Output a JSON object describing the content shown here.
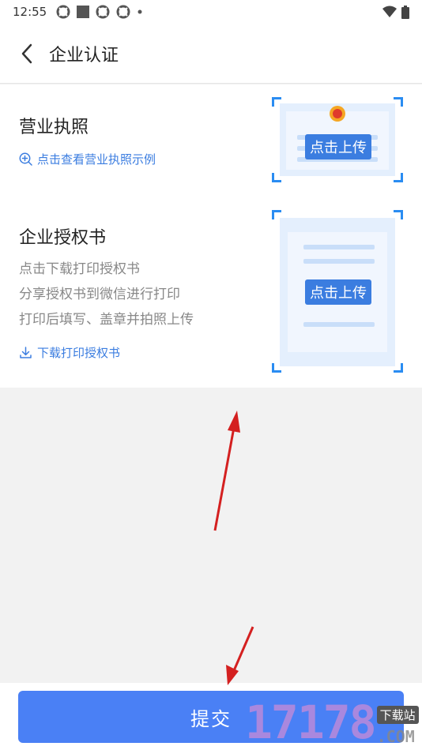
{
  "status_bar": {
    "time": "12:55"
  },
  "header": {
    "title": "企业认证"
  },
  "business_license": {
    "title": "营业执照",
    "example_link": "点击查看营业执照示例",
    "upload_label": "点击上传"
  },
  "authorization": {
    "title": "企业授权书",
    "steps": [
      "点击下载打印授权书",
      "分享授权书到微信进行打印",
      "打印后填写、盖章并拍照上传"
    ],
    "download_link": "下载打印授权书",
    "upload_label": "点击上传"
  },
  "footer": {
    "submit_label": "提交"
  },
  "watermark": {
    "number": "17178",
    "tag": "下载站",
    "domain": ".COM"
  },
  "colors": {
    "accent": "#4a80f5",
    "link": "#3b7de0",
    "annotation_arrow": "#d42020"
  }
}
